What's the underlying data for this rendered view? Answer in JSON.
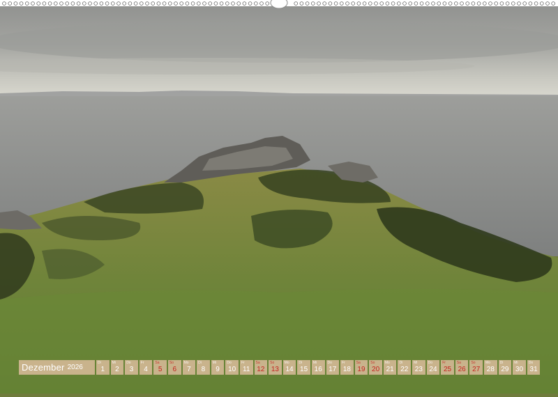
{
  "calendar": {
    "month": "Dezember",
    "year": "2026",
    "days": [
      {
        "wd": "Di",
        "d": "1",
        "sunday": false
      },
      {
        "wd": "Mi",
        "d": "2",
        "sunday": false
      },
      {
        "wd": "Do",
        "d": "3",
        "sunday": false
      },
      {
        "wd": "Fr",
        "d": "4",
        "sunday": false
      },
      {
        "wd": "Sa",
        "d": "5",
        "sunday": true
      },
      {
        "wd": "So",
        "d": "6",
        "sunday": true
      },
      {
        "wd": "Mo",
        "d": "7",
        "sunday": false
      },
      {
        "wd": "Di",
        "d": "8",
        "sunday": false
      },
      {
        "wd": "Mi",
        "d": "9",
        "sunday": false
      },
      {
        "wd": "Do",
        "d": "10",
        "sunday": false
      },
      {
        "wd": "Fr",
        "d": "11",
        "sunday": false
      },
      {
        "wd": "Sa",
        "d": "12",
        "sunday": true
      },
      {
        "wd": "So",
        "d": "13",
        "sunday": true
      },
      {
        "wd": "Mo",
        "d": "14",
        "sunday": false
      },
      {
        "wd": "Di",
        "d": "15",
        "sunday": false
      },
      {
        "wd": "Mi",
        "d": "16",
        "sunday": false
      },
      {
        "wd": "Do",
        "d": "17",
        "sunday": false
      },
      {
        "wd": "Fr",
        "d": "18",
        "sunday": false
      },
      {
        "wd": "Sa",
        "d": "19",
        "sunday": true
      },
      {
        "wd": "So",
        "d": "20",
        "sunday": true
      },
      {
        "wd": "Mo",
        "d": "21",
        "sunday": false
      },
      {
        "wd": "Di",
        "d": "22",
        "sunday": false
      },
      {
        "wd": "Mi",
        "d": "23",
        "sunday": false
      },
      {
        "wd": "Do",
        "d": "24",
        "sunday": false
      },
      {
        "wd": "Fr",
        "d": "25",
        "sunday": true
      },
      {
        "wd": "Sa",
        "d": "26",
        "sunday": true
      },
      {
        "wd": "So",
        "d": "27",
        "sunday": true
      },
      {
        "wd": "Mo",
        "d": "28",
        "sunday": false
      },
      {
        "wd": "Di",
        "d": "29",
        "sunday": false
      },
      {
        "wd": "Mi",
        "d": "30",
        "sunday": false
      },
      {
        "wd": "Do",
        "d": "31",
        "sunday": false
      }
    ]
  },
  "colors": {
    "sky": "#9c9c98",
    "sea": "#8c8e8d",
    "grass": "#7a8a3c",
    "heather": "#2f3a1c",
    "rock": "#5f5d58",
    "calendar_bar": "#c9b38c",
    "holiday_red": "#c4241f"
  },
  "icons": {
    "binding": "wire-binding-icon"
  }
}
